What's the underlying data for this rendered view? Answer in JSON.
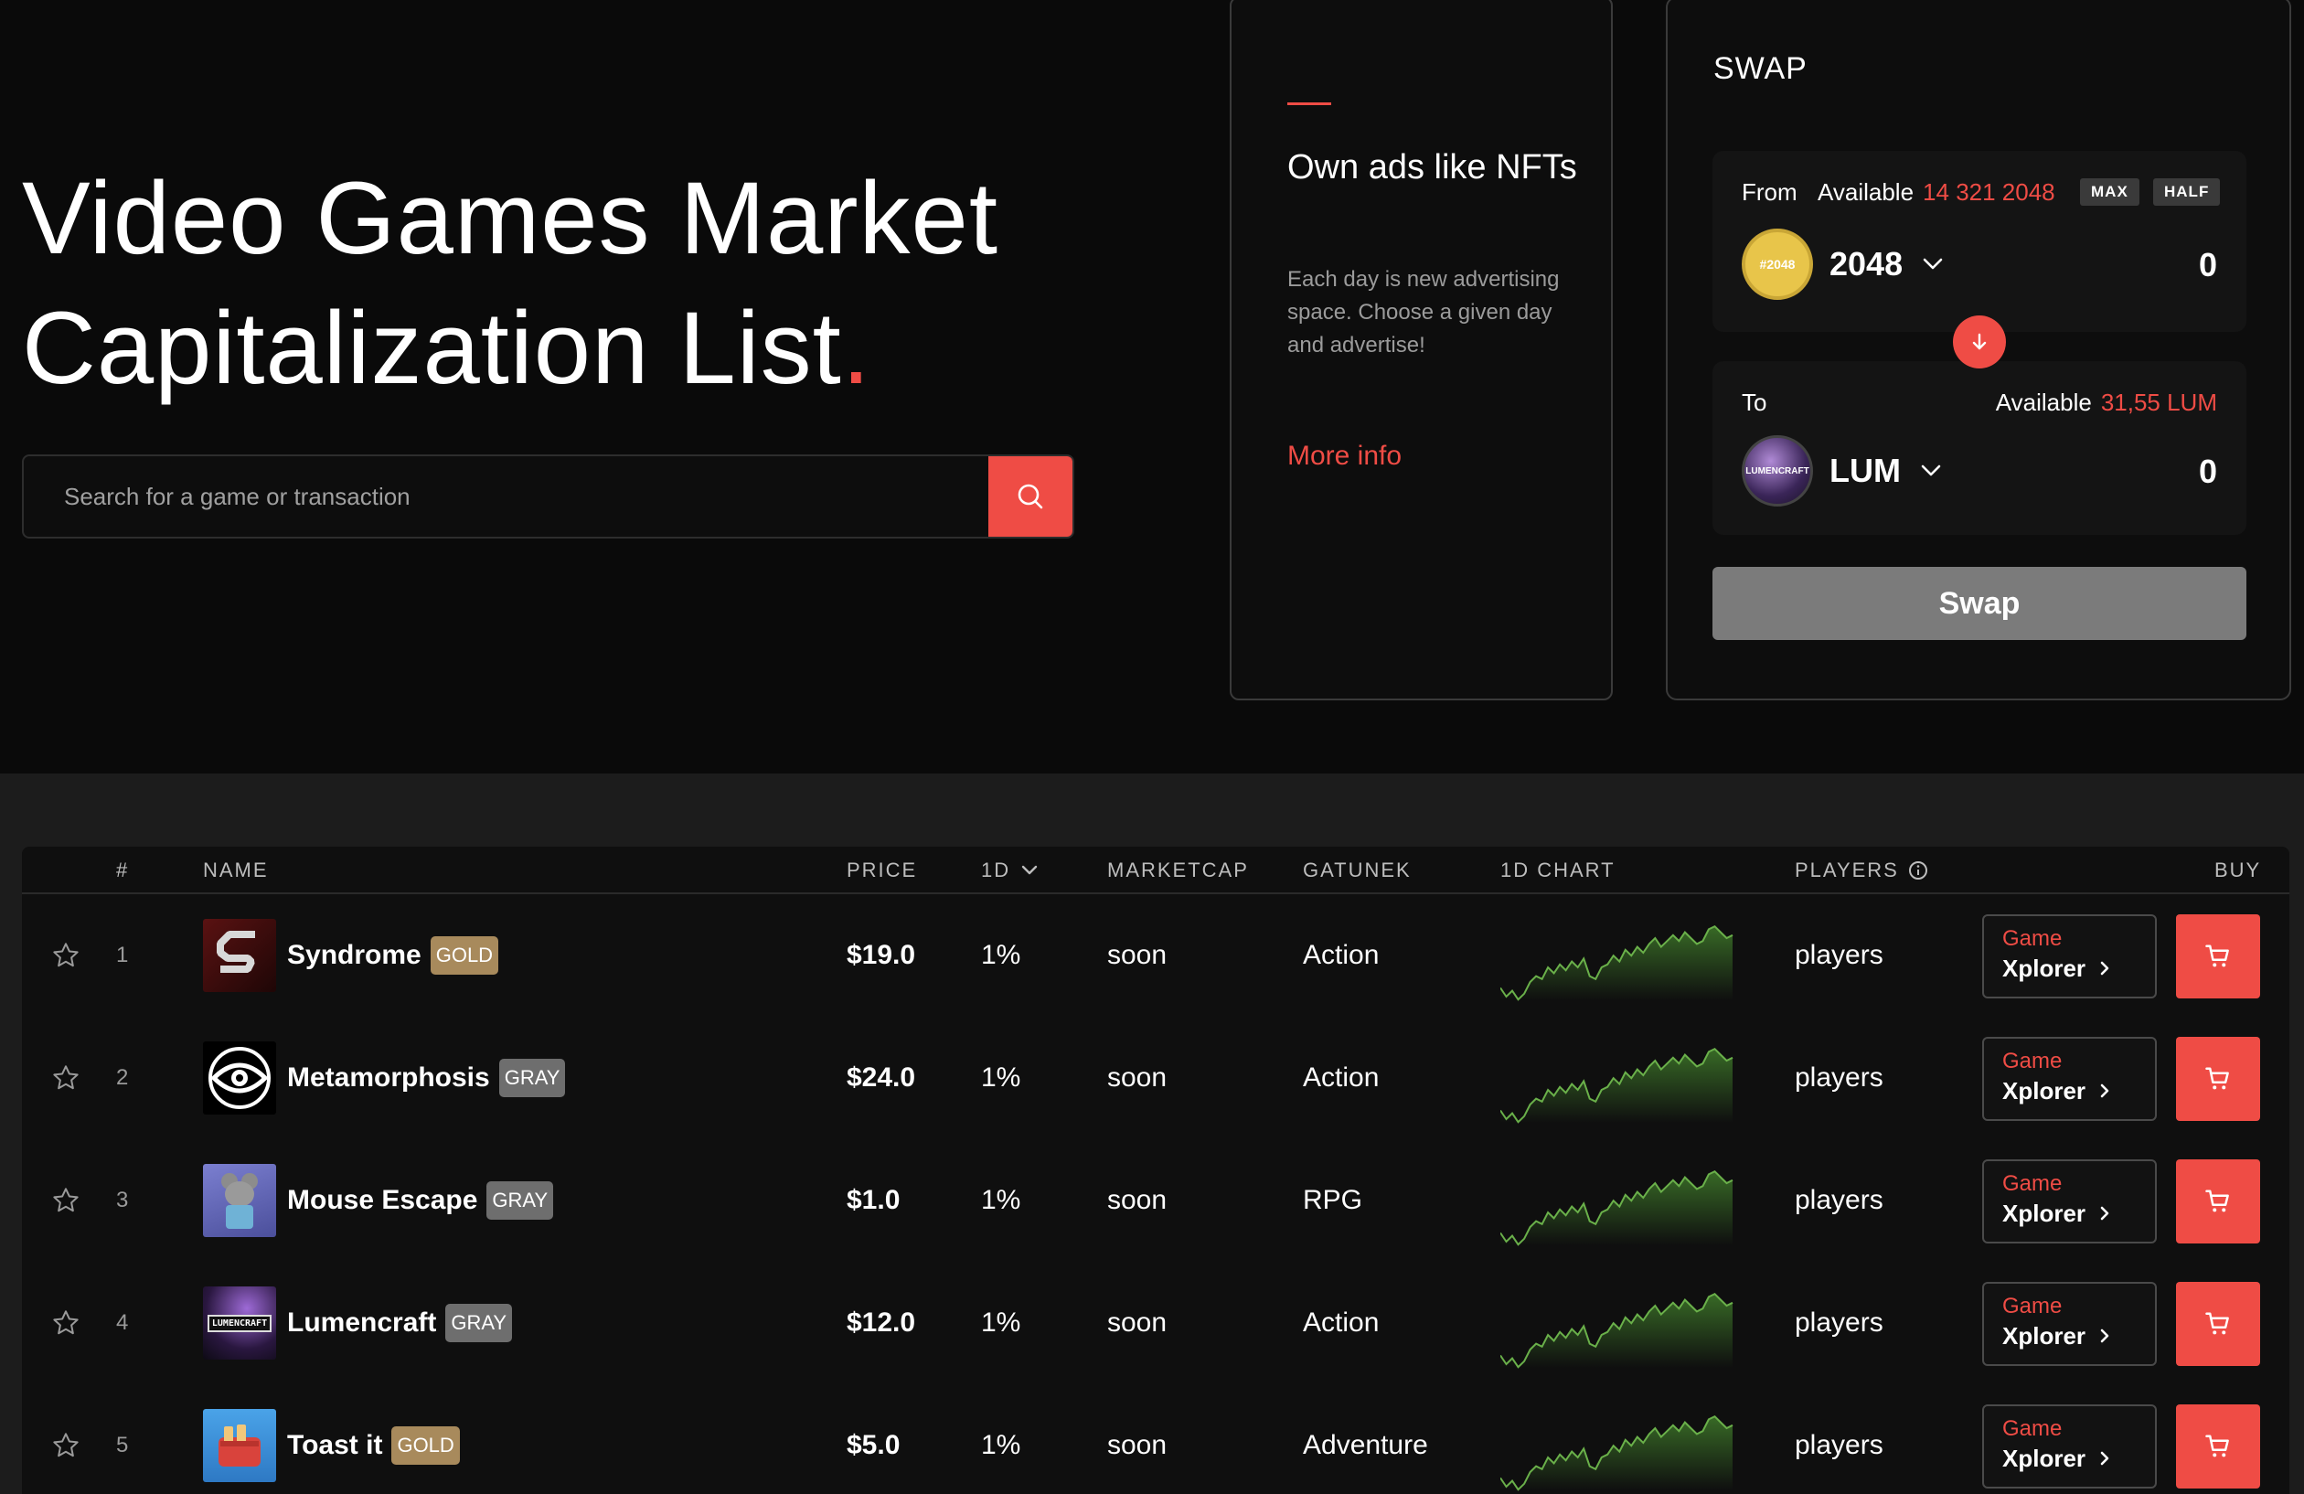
{
  "hero": {
    "title_line1": "Video Games Market",
    "title_line2": "Capitalization List",
    "title_dot": ".",
    "search_placeholder": "Search for a game or transaction"
  },
  "ads": {
    "title": "Own ads like NFTs",
    "description": "Each day is new advertising space. Choose a given day and advertise!",
    "link": "More info"
  },
  "swap": {
    "title": "SWAP",
    "from": {
      "label": "From",
      "available_label": "Available",
      "available_value": "14 321 2048",
      "max_label": "MAX",
      "half_label": "HALF",
      "token_badge": "#2048",
      "token": "2048",
      "amount": "0"
    },
    "to": {
      "label": "To",
      "available_label": "Available",
      "available_value": "31,55 LUM",
      "token_badge": "LUMENCRAFT",
      "token": "LUM",
      "amount": "0"
    },
    "button": "Swap",
    "accent_color": "#ef4c45"
  },
  "table": {
    "headers": {
      "rank": "#",
      "name": "NAME",
      "price": "PRICE",
      "change": "1D",
      "marketcap": "MARKETCAP",
      "genre": "GATUNEK",
      "chart": "1D CHART",
      "players": "PLAYERS",
      "buy": "BUY"
    },
    "xplorer_line1": "Game",
    "xplorer_line2": "Xplorer",
    "rows": [
      {
        "rank": "1",
        "name": "Syndrome",
        "tier": "GOLD",
        "price": "$19.0",
        "change": "1%",
        "marketcap": "soon",
        "genre": "Action",
        "players": "players"
      },
      {
        "rank": "2",
        "name": "Metamorphosis",
        "tier": "GRAY",
        "price": "$24.0",
        "change": "1%",
        "marketcap": "soon",
        "genre": "Action",
        "players": "players"
      },
      {
        "rank": "3",
        "name": "Mouse Escape",
        "tier": "GRAY",
        "price": "$1.0",
        "change": "1%",
        "marketcap": "soon",
        "genre": "RPG",
        "players": "players"
      },
      {
        "rank": "4",
        "name": "Lumencraft",
        "tier": "GRAY",
        "price": "$12.0",
        "change": "1%",
        "marketcap": "soon",
        "genre": "Action",
        "players": "players"
      },
      {
        "rank": "5",
        "name": "Toast it",
        "tier": "GOLD",
        "price": "$5.0",
        "change": "1%",
        "marketcap": "soon",
        "genre": "Adventure",
        "players": "players"
      }
    ]
  },
  "icons": [
    "search-icon",
    "chevron-down-icon",
    "arrow-down-icon",
    "star-icon",
    "info-icon",
    "chevron-right-icon",
    "cart-icon"
  ]
}
